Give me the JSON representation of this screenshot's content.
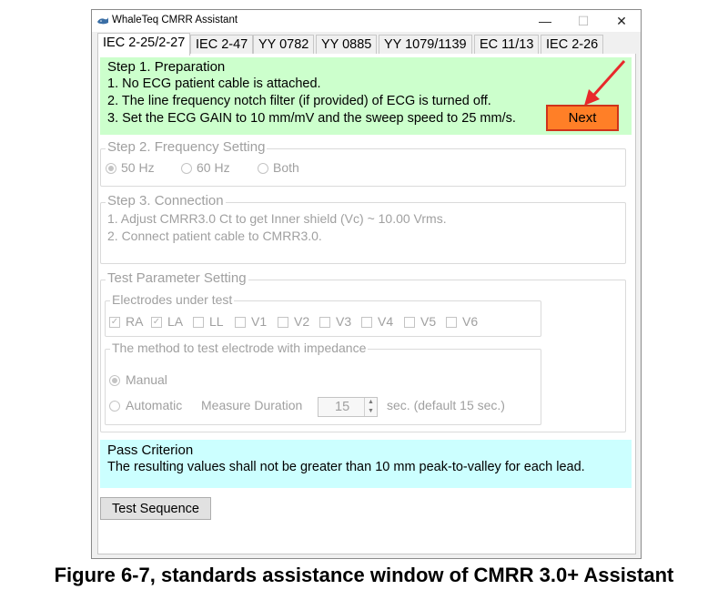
{
  "window": {
    "title": "WhaleTeq CMRR Assistant",
    "controls": {
      "minimize": "—",
      "maximize": "☐",
      "close": "✕"
    }
  },
  "tabs": [
    {
      "label": "IEC 2-25/2-27",
      "active": true
    },
    {
      "label": "IEC 2-47"
    },
    {
      "label": "YY 0782"
    },
    {
      "label": "YY 0885"
    },
    {
      "label": "YY 1079/1139"
    },
    {
      "label": "EC 11/13"
    },
    {
      "label": "IEC 2-26"
    }
  ],
  "step1": {
    "heading": "Step 1. Preparation",
    "lines": [
      "1. No ECG patient cable is attached.",
      "2. The line frequency notch filter (if provided) of ECG is turned off.",
      "3. Set the ECG GAIN to 10 mm/mV and the sweep speed to 25 mm/s."
    ],
    "next_label": "Next",
    "background": "#ccffcc",
    "next_color": "#ff7f27",
    "highlight_color": "#e8282b"
  },
  "step2": {
    "heading": "Step 2. Frequency Setting",
    "options": [
      "50 Hz",
      "60 Hz",
      "Both"
    ],
    "selected": "50 Hz"
  },
  "step3": {
    "heading": "Step 3. Connection",
    "lines": [
      "1. Adjust CMRR3.0 Ct to get Inner shield (Vc) ~ 10.00 Vrms.",
      "2. Connect patient cable to CMRR3.0."
    ]
  },
  "test_params": {
    "heading": "Test Parameter Setting",
    "electrodes": {
      "heading": "Electrodes under test",
      "items": [
        {
          "label": "RA",
          "checked": true
        },
        {
          "label": "LA",
          "checked": true
        },
        {
          "label": "LL",
          "checked": false
        },
        {
          "label": "V1",
          "checked": false
        },
        {
          "label": "V2",
          "checked": false
        },
        {
          "label": "V3",
          "checked": false
        },
        {
          "label": "V4",
          "checked": false
        },
        {
          "label": "V5",
          "checked": false
        },
        {
          "label": "V6",
          "checked": false
        }
      ]
    },
    "method": {
      "heading": "The method to test electrode with impedance",
      "manual_label": "Manual",
      "automatic_label": "Automatic",
      "selected": "Manual",
      "duration_label": "Measure Duration",
      "duration_value": "15",
      "duration_note": "sec. (default 15 sec.)"
    }
  },
  "pass_criterion": {
    "heading": "Pass Criterion",
    "text": "The resulting values shall not be greater than 10 mm peak-to-valley for each lead.",
    "background": "#ccffff"
  },
  "test_sequence_label": "Test Sequence",
  "caption": "Figure 6-7, standards assistance window of CMRR 3.0+ Assistant"
}
